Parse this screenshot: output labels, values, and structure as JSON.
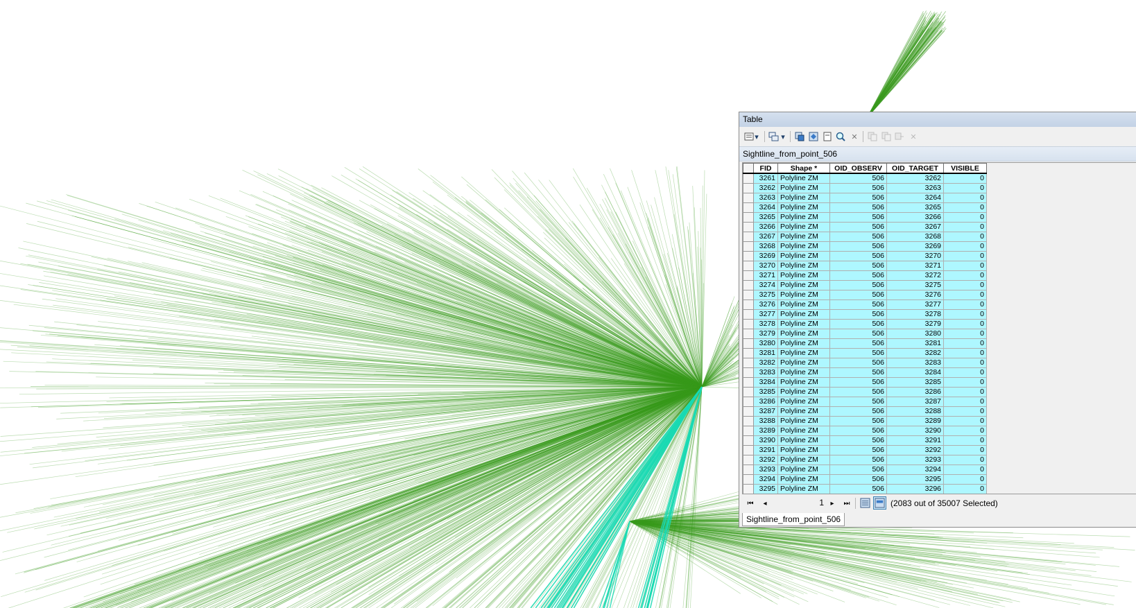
{
  "window": {
    "title": "Table"
  },
  "toolbar": {
    "icons": [
      "table-options-icon",
      "dropdown-arrow-icon",
      "related-tables-icon",
      "dropdown-arrow-icon",
      "select-by-attributes-icon",
      "switch-selection-icon",
      "clear-selection-icon",
      "zoom-to-selected-icon",
      "delete-selected-icon",
      "copy-selected-icon",
      "paste-icon",
      "undo-icon",
      "close-disabled-icon"
    ]
  },
  "layer_tab": {
    "name": "Sightline_from_point_506"
  },
  "columns": [
    "FID",
    "Shape *",
    "OID_OBSERV",
    "OID_TARGET",
    "VISIBLE"
  ],
  "rows": [
    [
      "3261",
      "Polyline ZM",
      "506",
      "3262",
      "0"
    ],
    [
      "3262",
      "Polyline ZM",
      "506",
      "3263",
      "0"
    ],
    [
      "3263",
      "Polyline ZM",
      "506",
      "3264",
      "0"
    ],
    [
      "3264",
      "Polyline ZM",
      "506",
      "3265",
      "0"
    ],
    [
      "3265",
      "Polyline ZM",
      "506",
      "3266",
      "0"
    ],
    [
      "3266",
      "Polyline ZM",
      "506",
      "3267",
      "0"
    ],
    [
      "3267",
      "Polyline ZM",
      "506",
      "3268",
      "0"
    ],
    [
      "3268",
      "Polyline ZM",
      "506",
      "3269",
      "0"
    ],
    [
      "3269",
      "Polyline ZM",
      "506",
      "3270",
      "0"
    ],
    [
      "3270",
      "Polyline ZM",
      "506",
      "3271",
      "0"
    ],
    [
      "3271",
      "Polyline ZM",
      "506",
      "3272",
      "0"
    ],
    [
      "3274",
      "Polyline ZM",
      "506",
      "3275",
      "0"
    ],
    [
      "3275",
      "Polyline ZM",
      "506",
      "3276",
      "0"
    ],
    [
      "3276",
      "Polyline ZM",
      "506",
      "3277",
      "0"
    ],
    [
      "3277",
      "Polyline ZM",
      "506",
      "3278",
      "0"
    ],
    [
      "3278",
      "Polyline ZM",
      "506",
      "3279",
      "0"
    ],
    [
      "3279",
      "Polyline ZM",
      "506",
      "3280",
      "0"
    ],
    [
      "3280",
      "Polyline ZM",
      "506",
      "3281",
      "0"
    ],
    [
      "3281",
      "Polyline ZM",
      "506",
      "3282",
      "0"
    ],
    [
      "3282",
      "Polyline ZM",
      "506",
      "3283",
      "0"
    ],
    [
      "3283",
      "Polyline ZM",
      "506",
      "3284",
      "0"
    ],
    [
      "3284",
      "Polyline ZM",
      "506",
      "3285",
      "0"
    ],
    [
      "3285",
      "Polyline ZM",
      "506",
      "3286",
      "0"
    ],
    [
      "3286",
      "Polyline ZM",
      "506",
      "3287",
      "0"
    ],
    [
      "3287",
      "Polyline ZM",
      "506",
      "3288",
      "0"
    ],
    [
      "3288",
      "Polyline ZM",
      "506",
      "3289",
      "0"
    ],
    [
      "3289",
      "Polyline ZM",
      "506",
      "3290",
      "0"
    ],
    [
      "3290",
      "Polyline ZM",
      "506",
      "3291",
      "0"
    ],
    [
      "3291",
      "Polyline ZM",
      "506",
      "3292",
      "0"
    ],
    [
      "3292",
      "Polyline ZM",
      "506",
      "3293",
      "0"
    ],
    [
      "3293",
      "Polyline ZM",
      "506",
      "3294",
      "0"
    ],
    [
      "3294",
      "Polyline ZM",
      "506",
      "3295",
      "0"
    ],
    [
      "3295",
      "Polyline ZM",
      "506",
      "3296",
      "0"
    ]
  ],
  "navigation": {
    "current_record": "1",
    "selected_status": "(2083 out of 35007 Selected)"
  },
  "bottom_tab": {
    "name": "Sightline_from_point_506"
  },
  "colors": {
    "sightline_green": "#3a9a1e",
    "sightline_visible_cyan": "#19d9b3",
    "selected_row": "#aef7ff"
  }
}
